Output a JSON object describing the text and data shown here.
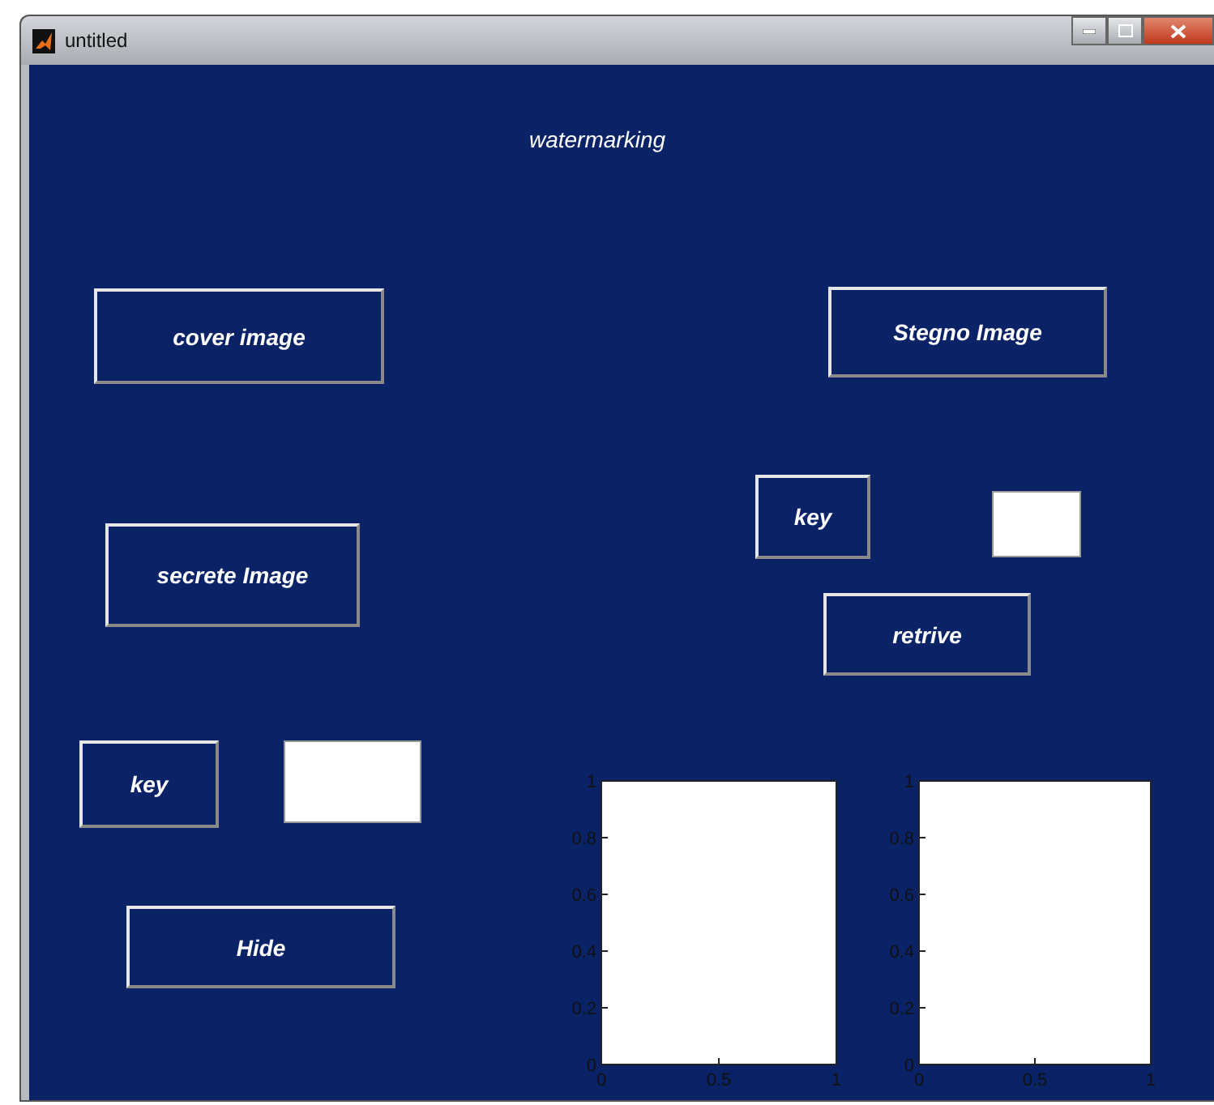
{
  "window": {
    "title": "untitled"
  },
  "heading": "watermarking",
  "controls": [
    {
      "kind": "button",
      "label": "cover image"
    },
    {
      "kind": "button",
      "label": "Stegno Image"
    },
    {
      "kind": "button",
      "label": "key"
    },
    {
      "kind": "field"
    },
    {
      "kind": "button",
      "label": "retrive"
    },
    {
      "kind": "button",
      "label": "secrete Image"
    },
    {
      "kind": "button",
      "label": "key"
    },
    {
      "kind": "field"
    },
    {
      "kind": "button",
      "label": "Hide"
    }
  ],
  "axes": [
    {
      "chart_data": {
        "type": "line",
        "xlim": [
          0,
          1
        ],
        "ylim": [
          0,
          1
        ],
        "xticks": [
          {
            "value": 0,
            "label": "0"
          },
          {
            "value": 0.5,
            "label": "0.5"
          },
          {
            "value": 1,
            "label": "1"
          }
        ],
        "yticks": [
          {
            "value": 0,
            "label": "0"
          },
          {
            "value": 0.2,
            "label": "0.2"
          },
          {
            "value": 0.4,
            "label": "0.4"
          },
          {
            "value": 0.6,
            "label": "0.6"
          },
          {
            "value": 0.8,
            "label": "0.8"
          },
          {
            "value": 1,
            "label": "1"
          }
        ]
      }
    },
    {
      "chart_data": {
        "type": "line",
        "xlim": [
          0,
          1
        ],
        "ylim": [
          0,
          1
        ],
        "xticks": [
          {
            "value": 0,
            "label": "0"
          },
          {
            "value": 0.5,
            "label": "0.5"
          },
          {
            "value": 1,
            "label": "1"
          }
        ],
        "yticks": [
          {
            "value": 0,
            "label": "0"
          },
          {
            "value": 0.2,
            "label": "0.2"
          },
          {
            "value": 0.4,
            "label": "0.4"
          },
          {
            "value": 0.6,
            "label": "0.6"
          },
          {
            "value": 0.8,
            "label": "0.8"
          },
          {
            "value": 1,
            "label": "1"
          }
        ]
      }
    }
  ]
}
